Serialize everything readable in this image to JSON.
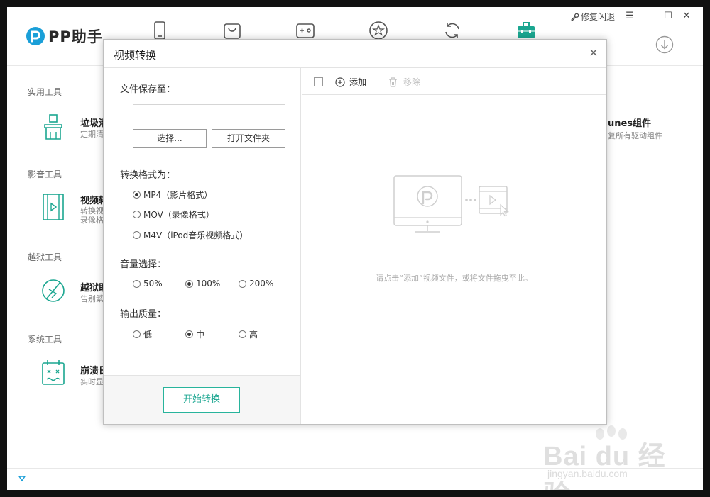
{
  "app": {
    "title": "PP助手",
    "repair_label": "修复闪退",
    "accent_color": "#1aa690",
    "nav": [
      {
        "name": "device-icon"
      },
      {
        "name": "apps-icon"
      },
      {
        "name": "games-icon"
      },
      {
        "name": "favorites-icon"
      },
      {
        "name": "sync-icon"
      },
      {
        "name": "toolbox-icon",
        "active": true
      }
    ]
  },
  "categories": [
    {
      "title": "实用工具",
      "tool_name": "垃圾清",
      "tool_desc": [
        "定期清"
      ]
    },
    {
      "title": "影音工具",
      "tool_name": "视频转",
      "tool_desc": [
        "转换视",
        "录像格"
      ]
    },
    {
      "title": "越狱工具",
      "tool_name": "越狱助",
      "tool_desc": [
        "告别繁"
      ]
    },
    {
      "title": "系统工具",
      "tool_name": "崩溃日",
      "tool_desc": [
        "实时显"
      ]
    }
  ],
  "itunes": {
    "name": "unes组件",
    "desc": "复所有驱动组件"
  },
  "dialog": {
    "title": "视频转换",
    "save_to_label": "文件保存至：",
    "save_path_value": "",
    "choose_button": "选择...",
    "open_folder_button": "打开文件夹",
    "format_label": "转换格式为：",
    "formats": [
      {
        "label": "MP4（影片格式）",
        "checked": true
      },
      {
        "label": "MOV（录像格式）",
        "checked": false
      },
      {
        "label": "M4V（iPod音乐视频格式）",
        "checked": false
      }
    ],
    "volume_label": "音量选择：",
    "volumes": [
      {
        "label": "50%",
        "checked": false
      },
      {
        "label": "100%",
        "checked": true
      },
      {
        "label": "200%",
        "checked": false
      }
    ],
    "quality_label": "输出质量：",
    "qualities": [
      {
        "label": "低",
        "checked": false
      },
      {
        "label": "中",
        "checked": true
      },
      {
        "label": "高",
        "checked": false
      }
    ],
    "start_button": "开始转换",
    "add_button": "添加",
    "remove_button": "移除",
    "empty_hint": "请点击“添加”视频文件，或将文件拖曳至此。"
  },
  "watermark": {
    "brand": "Bai du 经验",
    "site": "jingyan.baidu.com"
  }
}
